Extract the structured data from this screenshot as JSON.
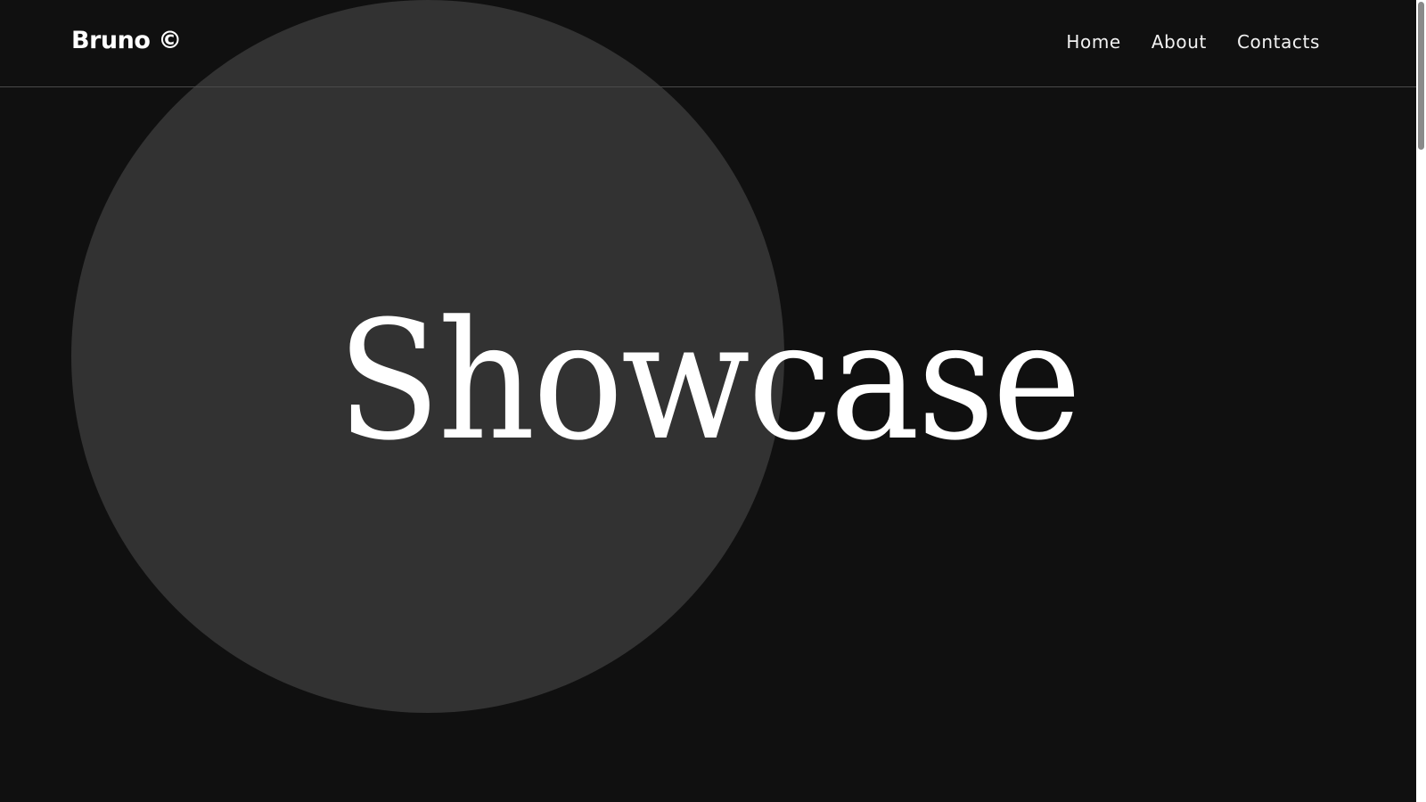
{
  "header": {
    "brand": "Bruno ©",
    "nav": [
      "Home",
      "About",
      "Contacts"
    ]
  },
  "hero": {
    "title": "Showcase"
  },
  "colors": {
    "background": "#101010",
    "circle": "#323232",
    "text": "#ffffff"
  }
}
